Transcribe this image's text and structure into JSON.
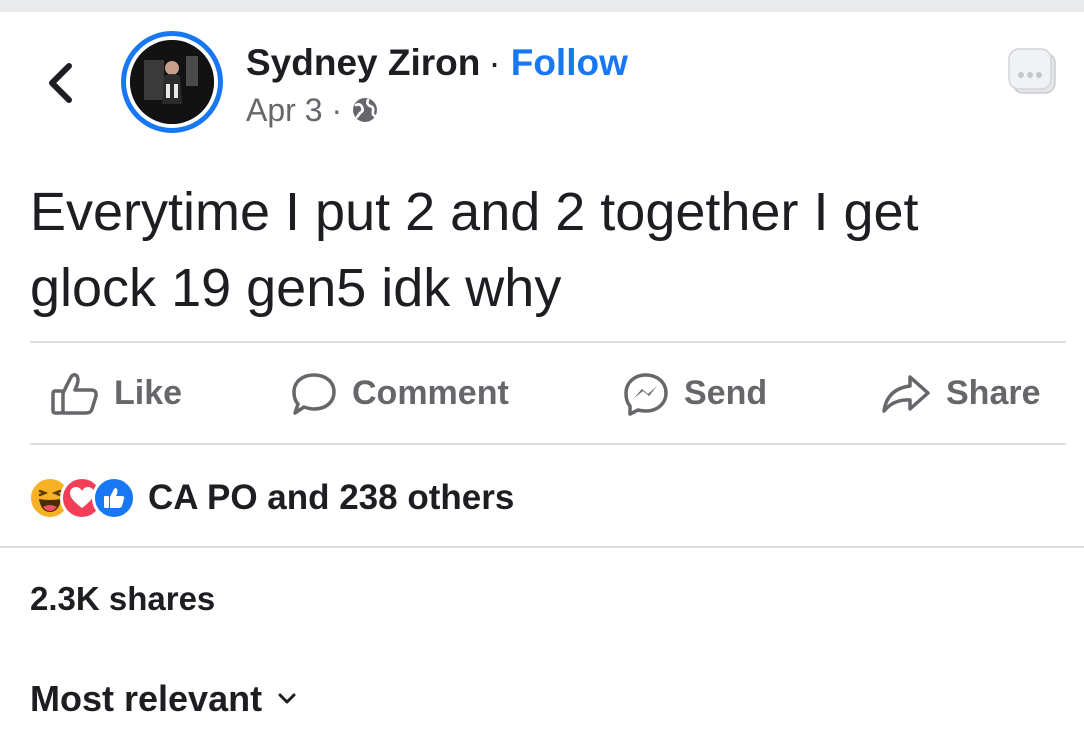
{
  "post": {
    "author": {
      "name": "Sydney Ziron",
      "separator": "·",
      "follow_label": "Follow"
    },
    "meta": {
      "date": "Apr 3",
      "separator": "·",
      "audience_icon": "globe-icon"
    },
    "text_line1": "Everytime I put 2 and 2 together I get",
    "text_line2": "glock 19 gen5 idk why"
  },
  "actions": [
    {
      "label": "Like",
      "icon": "thumbs-up-icon"
    },
    {
      "label": "Comment",
      "icon": "comment-bubble-icon"
    },
    {
      "label": "Send",
      "icon": "messenger-icon"
    },
    {
      "label": "Share",
      "icon": "share-arrow-icon"
    }
  ],
  "reactions": {
    "icons": [
      "haha-reaction-icon",
      "love-reaction-icon",
      "like-reaction-icon"
    ],
    "summary": "CA PO and 238 others"
  },
  "shares_label": "2.3K shares",
  "comments_sort": {
    "label": "Most relevant",
    "icon": "chevron-down-icon"
  },
  "colors": {
    "accent": "#1877f2",
    "text": "#1c1e21",
    "muted": "#65676b",
    "love": "#f33e58",
    "haha": "#f7b125",
    "divider": "#dcdde0"
  }
}
